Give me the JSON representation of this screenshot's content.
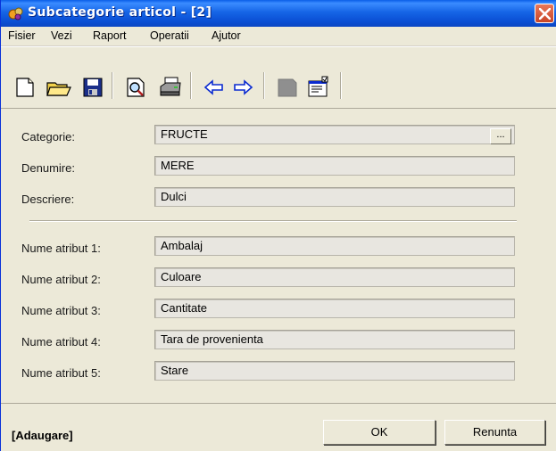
{
  "window": {
    "title": "Subcategorie articol - [2]"
  },
  "menu": {
    "items": [
      "Fisier",
      "Vezi",
      "Raport",
      "Operatii",
      "Ajutor"
    ]
  },
  "toolbar": {
    "buttons": [
      {
        "icon": "new-document-icon"
      },
      {
        "icon": "open-folder-icon"
      },
      {
        "icon": "save-icon"
      },
      {
        "icon": "print-preview-icon"
      },
      {
        "icon": "print-icon"
      },
      {
        "icon": "arrow-left-icon"
      },
      {
        "icon": "arrow-right-icon"
      },
      {
        "icon": "gray-block-icon"
      },
      {
        "icon": "properties-icon"
      }
    ]
  },
  "form": {
    "categorie_label": "Categorie:",
    "categorie_value": "FRUCTE",
    "ellipsis_label": "...",
    "denumire_label": "Denumire:",
    "denumire_value": "MERE",
    "descriere_label": "Descriere:",
    "descriere_value": "Dulci",
    "attributes": [
      {
        "label": "Nume atribut 1:",
        "value": "Ambalaj"
      },
      {
        "label": "Nume atribut 2:",
        "value": "Culoare"
      },
      {
        "label": "Nume atribut 3:",
        "value": "Cantitate"
      },
      {
        "label": "Nume atribut 4:",
        "value": "Tara de provenienta"
      },
      {
        "label": "Nume atribut 5:",
        "value": "Stare"
      }
    ]
  },
  "status": {
    "mode": "[Adaugare]",
    "ok_label": "OK",
    "cancel_label": "Renunta"
  }
}
